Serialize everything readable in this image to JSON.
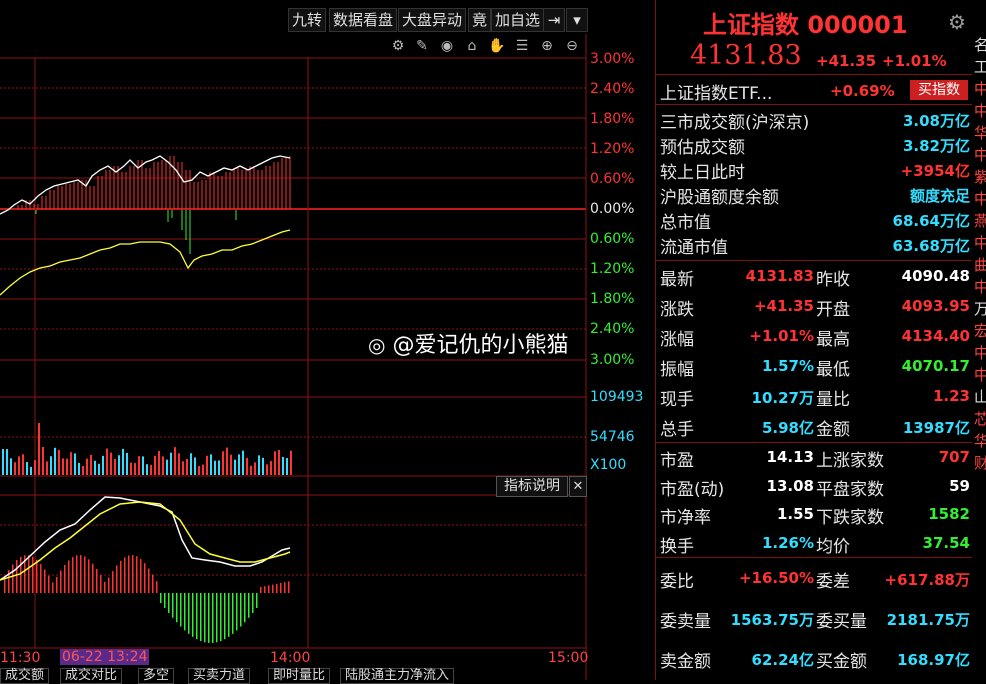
{
  "toolbar": {
    "buttons": [
      "九转",
      "数据看盘",
      "大盘异动",
      "竟",
      "加自选"
    ],
    "icons": [
      "settings-icon",
      "pen-icon",
      "eye-icon",
      "basket-icon",
      "hand-icon",
      "zoom-in-icon",
      "zoom-out-icon"
    ]
  },
  "chart": {
    "right_axis_upper": [
      "3.00%",
      "2.40%",
      "1.80%",
      "1.20%",
      "0.60%",
      "0.00%",
      "0.60%",
      "1.20%",
      "1.80%",
      "2.40%",
      "3.00%"
    ],
    "volume_axis": [
      "109493",
      "54746",
      "X100"
    ],
    "indicator_button": "指标说明",
    "indicator_close": "✕",
    "x_axis": {
      "left": "11:30",
      "cursor": "06-22 13:24",
      "mid": "14:00",
      "right": "15:00"
    },
    "bottom_tabs": [
      "成交额",
      "成交对比",
      "多空",
      "买卖力道",
      "即时量比",
      "陆股通主力净流入"
    ],
    "watermark": "@爱记仇的小熊猫"
  },
  "panel": {
    "title": "上证指数 000001",
    "price": "4131.83",
    "change": "+41.35",
    "change_pct": "+1.01%",
    "etf_name": "上证指数ETF...",
    "etf_pct": "+0.69%",
    "etf_button": "买指数",
    "stats1": [
      {
        "label": "三市成交额(沪深京)",
        "value": "3.08万亿"
      },
      {
        "label": "预估成交额",
        "value": "3.82万亿"
      },
      {
        "label": "较上日此时",
        "value": "+3954亿"
      },
      {
        "label": "沪股通额度余额",
        "value": "额度充足"
      },
      {
        "label": "总市值",
        "value": "68.64万亿"
      },
      {
        "label": "流通市值",
        "value": "63.68万亿"
      }
    ],
    "quote_rows": [
      {
        "l1": "最新",
        "v1": "4131.83",
        "l2": "昨收",
        "v2": "4090.48"
      },
      {
        "l1": "涨跌",
        "v1": "+41.35",
        "l2": "开盘",
        "v2": "4093.95"
      },
      {
        "l1": "涨幅",
        "v1": "+1.01%",
        "l2": "最高",
        "v2": "4134.40"
      },
      {
        "l1": "振幅",
        "v1": "1.57%",
        "l2": "最低",
        "v2": "4070.17"
      },
      {
        "l1": "现手",
        "v1": "10.27万",
        "l2": "量比",
        "v2": "1.23"
      },
      {
        "l1": "总手",
        "v1": "5.98亿",
        "l2": "金额",
        "v2": "13987亿"
      }
    ],
    "valuation_rows": [
      {
        "l1": "市盈",
        "v1": "14.13",
        "l2": "上涨家数",
        "v2": "707"
      },
      {
        "l1": "市盈(动)",
        "v1": "13.08",
        "l2": "平盘家数",
        "v2": "59"
      },
      {
        "l1": "市净率",
        "v1": "1.55",
        "l2": "下跌家数",
        "v2": "1582"
      },
      {
        "l1": "换手",
        "v1": "1.26%",
        "l2": "均价",
        "v2": "37.54"
      }
    ],
    "order_rows": [
      {
        "l1": "委比",
        "v1": "+16.50%",
        "l2": "委差",
        "v2": "+617.88万"
      },
      {
        "l1": "委卖量",
        "v1": "1563.75万",
        "l2": "委买量",
        "v2": "2181.75万"
      },
      {
        "l1": "卖金额",
        "v1": "62.24亿",
        "l2": "买金额",
        "v2": "168.97亿"
      }
    ],
    "edge_chars": [
      "名",
      "工",
      "中",
      "中",
      "华",
      "中",
      "紫",
      "中",
      "燕",
      "中",
      "曲",
      "中",
      "万",
      "宏",
      "中",
      "中",
      "山",
      "芯",
      "华",
      "财"
    ]
  },
  "colors": {
    "up": "#ff3333",
    "down": "#33ee33",
    "grid": "#8b1515",
    "avg": "#ffff33",
    "price": "#ffffff"
  }
}
